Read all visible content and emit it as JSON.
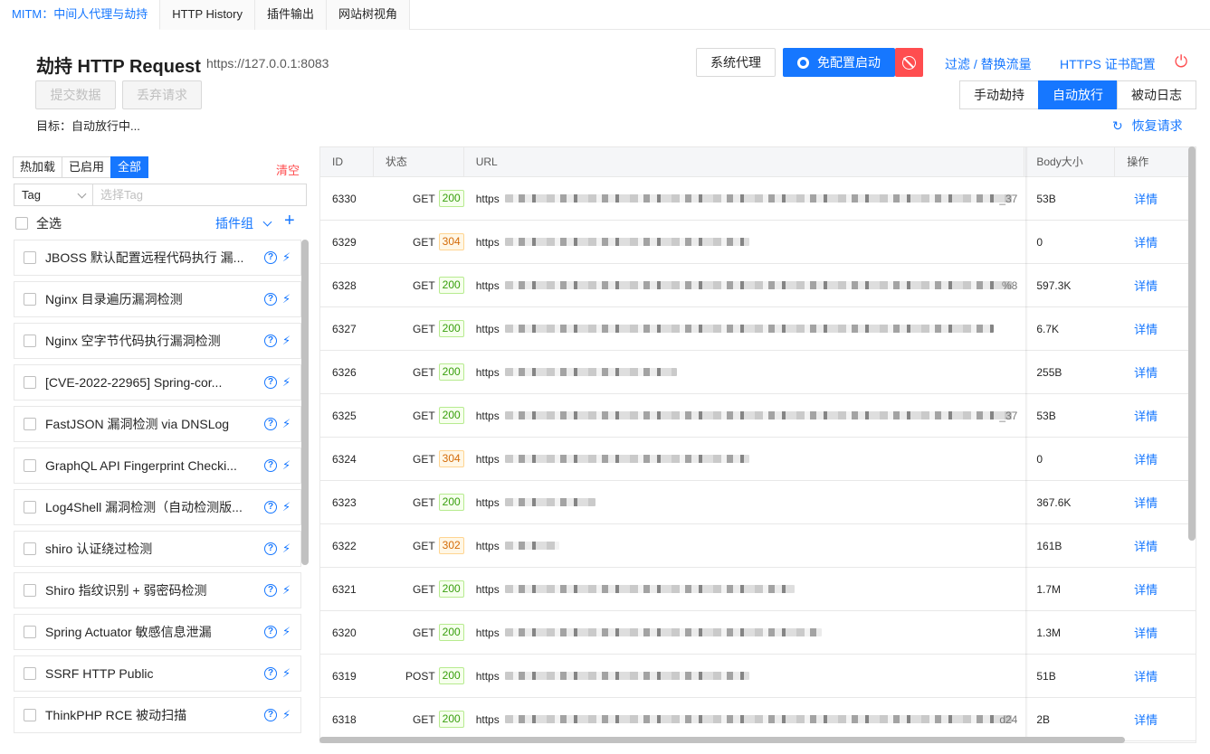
{
  "tabs": [
    "MITM：中间人代理与劫持",
    "HTTP History",
    "插件输出",
    "网站树视角"
  ],
  "header": {
    "title": "劫持 HTTP Request",
    "address": "https://127.0.0.1:8083",
    "submit": "提交数据",
    "discard": "丢弃请求",
    "target": "目标：自动放行中..."
  },
  "toolbar": {
    "system_proxy": "系统代理",
    "start": "免配置启动",
    "filter": "过滤 / 替换流量",
    "https_cert": "HTTPS 证书配置"
  },
  "modes": [
    "手动劫持",
    "自动放行",
    "被动日志"
  ],
  "active_mode": "自动放行",
  "restore": "恢复请求",
  "left": {
    "filters": [
      "热加载",
      "已启用",
      "全部"
    ],
    "active_filter": "全部",
    "clear": "清空",
    "tag_label": "Tag",
    "tag_placeholder": "选择Tag",
    "select_all": "全选",
    "plugin_group": "插件组",
    "plugins": [
      "JBOSS 默认配置远程代码执行 漏...",
      "Nginx 目录遍历漏洞检测",
      "Nginx 空字节代码执行漏洞检测",
      "[CVE-2022-22965] Spring-cor...",
      "FastJSON 漏洞检测 via DNSLog",
      "GraphQL API Fingerprint Checki...",
      "Log4Shell 漏洞检测（自动检测版...",
      "shiro 认证绕过检测",
      "Shiro 指纹识别 + 弱密码检测",
      "Spring Actuator 敏感信息泄漏",
      "SSRF HTTP Public",
      "ThinkPHP RCE 被动扫描"
    ]
  },
  "table": {
    "columns": [
      "ID",
      "状态",
      "URL",
      "Body大小",
      "操作"
    ],
    "rows": [
      {
        "id": "6330",
        "method": "GET",
        "code": "200",
        "url": "https",
        "tail": "_37",
        "size": "53B",
        "op": "详情"
      },
      {
        "id": "6329",
        "method": "GET",
        "code": "304",
        "url": "https",
        "tail": "",
        "size": "0",
        "op": "详情"
      },
      {
        "id": "6328",
        "method": "GET",
        "code": "200",
        "url": "https",
        "tail": "%8",
        "size": "597.3K",
        "op": "详情"
      },
      {
        "id": "6327",
        "method": "GET",
        "code": "200",
        "url": "https",
        "tail": "",
        "size": "6.7K",
        "op": "详情"
      },
      {
        "id": "6326",
        "method": "GET",
        "code": "200",
        "url": "https",
        "tail": "",
        "size": "255B",
        "op": "详情"
      },
      {
        "id": "6325",
        "method": "GET",
        "code": "200",
        "url": "https",
        "tail": "_37",
        "size": "53B",
        "op": "详情"
      },
      {
        "id": "6324",
        "method": "GET",
        "code": "304",
        "url": "https",
        "tail": "",
        "size": "0",
        "op": "详情"
      },
      {
        "id": "6323",
        "method": "GET",
        "code": "200",
        "url": "https",
        "tail": "",
        "size": "367.6K",
        "op": "详情"
      },
      {
        "id": "6322",
        "method": "GET",
        "code": "302",
        "url": "https",
        "tail": "",
        "size": "161B",
        "op": "详情"
      },
      {
        "id": "6321",
        "method": "GET",
        "code": "200",
        "url": "https",
        "tail": "",
        "size": "1.7M",
        "op": "详情"
      },
      {
        "id": "6320",
        "method": "GET",
        "code": "200",
        "url": "https",
        "tail": "",
        "size": "1.3M",
        "op": "详情"
      },
      {
        "id": "6319",
        "method": "POST",
        "code": "200",
        "url": "https",
        "tail": "",
        "size": "51B",
        "op": "详情"
      },
      {
        "id": "6318",
        "method": "GET",
        "code": "200",
        "url": "https",
        "tail": "d24",
        "size": "2B",
        "op": "详情"
      }
    ]
  },
  "colors": {
    "accent": "#1677ff",
    "danger": "#ff4d4f",
    "ok": "#389e0d",
    "warn": "#d46b08"
  }
}
